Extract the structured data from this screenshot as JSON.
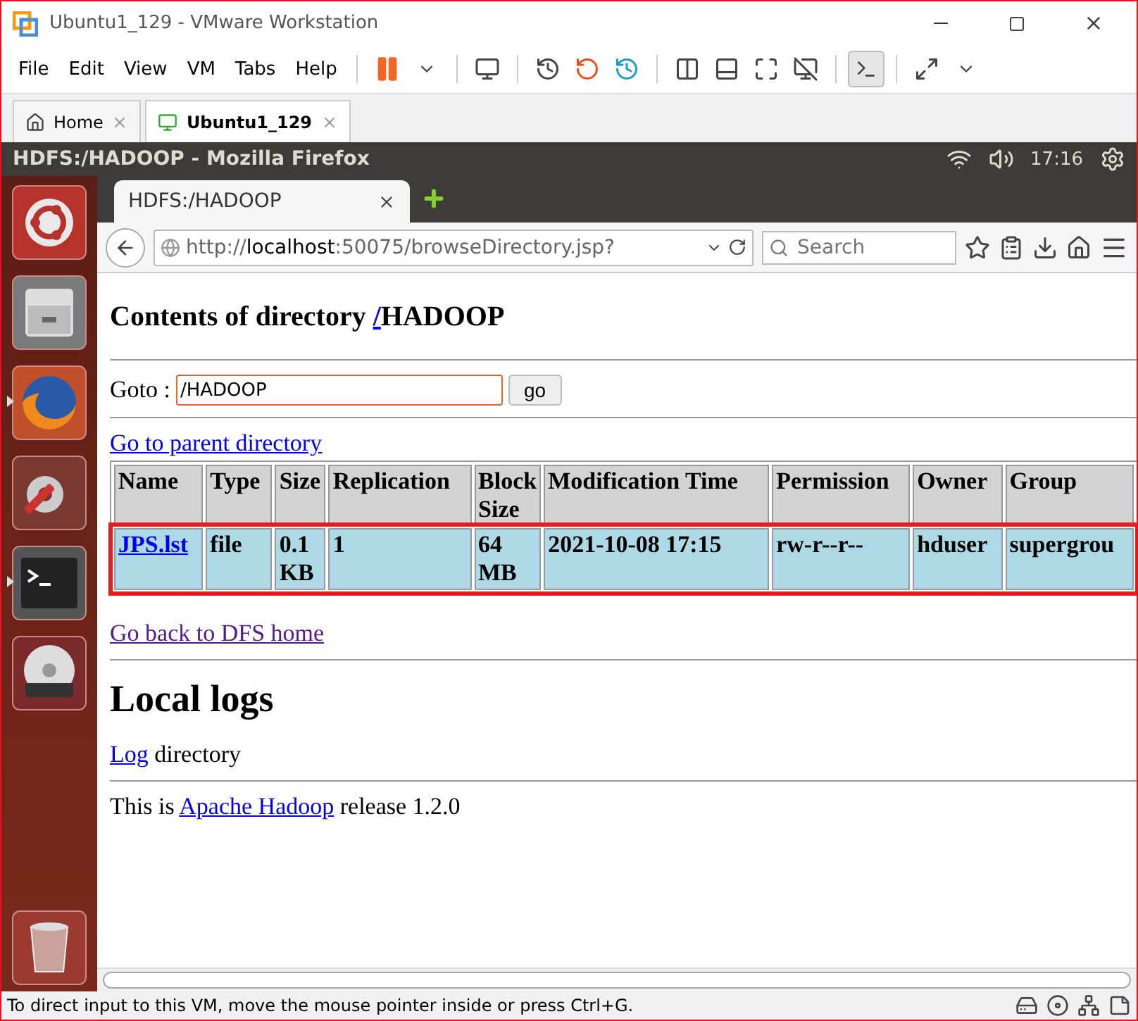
{
  "window": {
    "title": "Ubuntu1_129 - VMware Workstation"
  },
  "menu": [
    "File",
    "Edit",
    "View",
    "VM",
    "Tabs",
    "Help"
  ],
  "vm_tabs": [
    {
      "label": "Home",
      "selected": false
    },
    {
      "label": "Ubuntu1_129",
      "selected": true
    }
  ],
  "guest_bar": {
    "title": "HDFS:/HADOOP - Mozilla Firefox",
    "clock": "17:16"
  },
  "launcher": [
    {
      "kind": "ubuntu",
      "running": false
    },
    {
      "kind": "files",
      "running": false
    },
    {
      "kind": "firefox",
      "running": true
    },
    {
      "kind": "settings",
      "running": false
    },
    {
      "kind": "terminal",
      "running": true
    },
    {
      "kind": "dvd",
      "running": false
    }
  ],
  "browser": {
    "tab": "HDFS:/HADOOP",
    "url": "http://**localhost**:50075/browseDirectory.jsp?",
    "search_placeholder": "Search"
  },
  "page": {
    "heading": "Contents of directory ",
    "heading_link": "/",
    "heading_rest": "HADOOP",
    "goto_label": "Goto :",
    "goto_value": "/HADOOP",
    "goto_button": "go",
    "parent_link": "Go to parent directory",
    "columns": [
      "Name",
      "Type",
      "Size",
      "Replication",
      "Block Size",
      "Modification Time",
      "Permission",
      "Owner",
      "Group"
    ],
    "rows": [
      {
        "selected": true,
        "cells": [
          "JPS.lst",
          "file",
          "0.1 KB",
          "1",
          "64 MB",
          "2021-10-08 17:15",
          "rw-r--r--",
          "hduser",
          "supergrou"
        ]
      }
    ],
    "home_link": "Go back to DFS home",
    "logs_heading": "Local logs",
    "log_link": "Log",
    "log_text": " directory",
    "release_prefix": "This is ",
    "release_link": "Apache Hadoop",
    "release_suffix": " release 1.2.0"
  },
  "status_bar": "To direct input to this VM, move the mouse pointer inside or press Ctrl+G."
}
